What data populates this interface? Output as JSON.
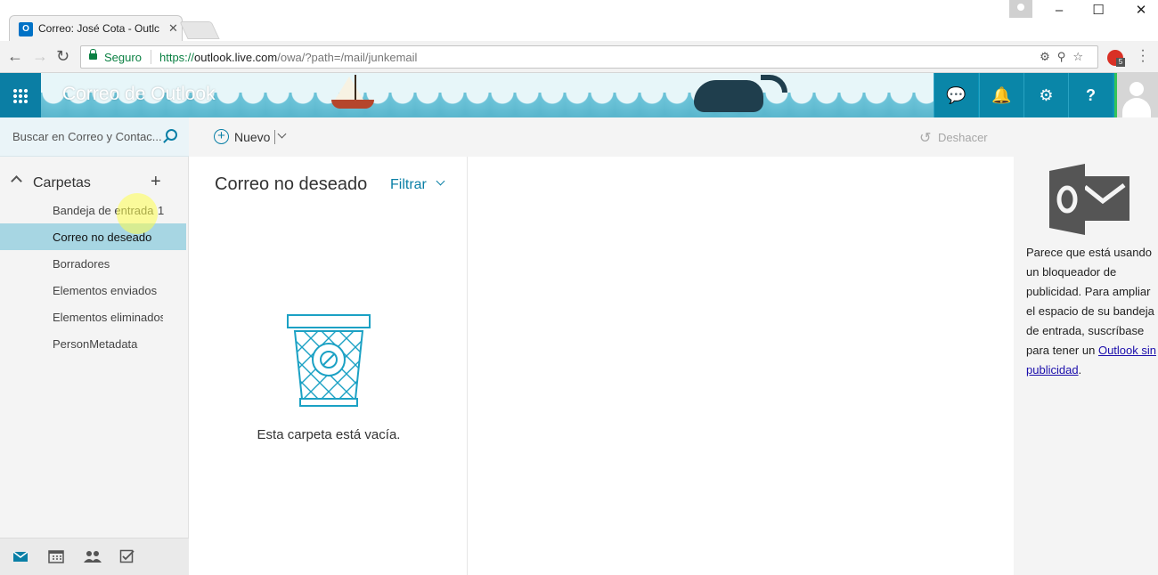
{
  "browser": {
    "tab_title": "Correo: José Cota - Outlc",
    "tab_favicon": "O",
    "secure_label": "Seguro",
    "url_scheme": "https://",
    "url_host": "outlook.live.com",
    "url_path": "/owa/?path=/mail/junkemail",
    "extension_badge": "5"
  },
  "header": {
    "title": "Correo de Outlook"
  },
  "search": {
    "placeholder": "Buscar en Correo y Contac..."
  },
  "commands": {
    "new_label": "Nuevo",
    "undo_label": "Deshacer"
  },
  "folders": {
    "label": "Carpetas",
    "items": [
      {
        "label": "Bandeja de entrada",
        "count": "1"
      },
      {
        "label": "Correo no deseado"
      },
      {
        "label": "Borradores"
      },
      {
        "label": "Elementos enviados"
      },
      {
        "label": "Elementos eliminados"
      },
      {
        "label": "PersonMetadata"
      }
    ]
  },
  "message_list": {
    "title": "Correo no deseado",
    "filter_label": "Filtrar",
    "empty_text": "Esta carpeta está vacía."
  },
  "ad": {
    "text_before": "Parece que está usando un bloqueador de publicidad. Para ampliar el espacio de su bandeja de entrada, suscríbase para tener un ",
    "link_text": "Outlook sin publicidad",
    "text_after": "."
  },
  "colors": {
    "brand": "#0a94b8",
    "accent": "#0a7fa6",
    "selected_folder": "#a7d6e3"
  }
}
